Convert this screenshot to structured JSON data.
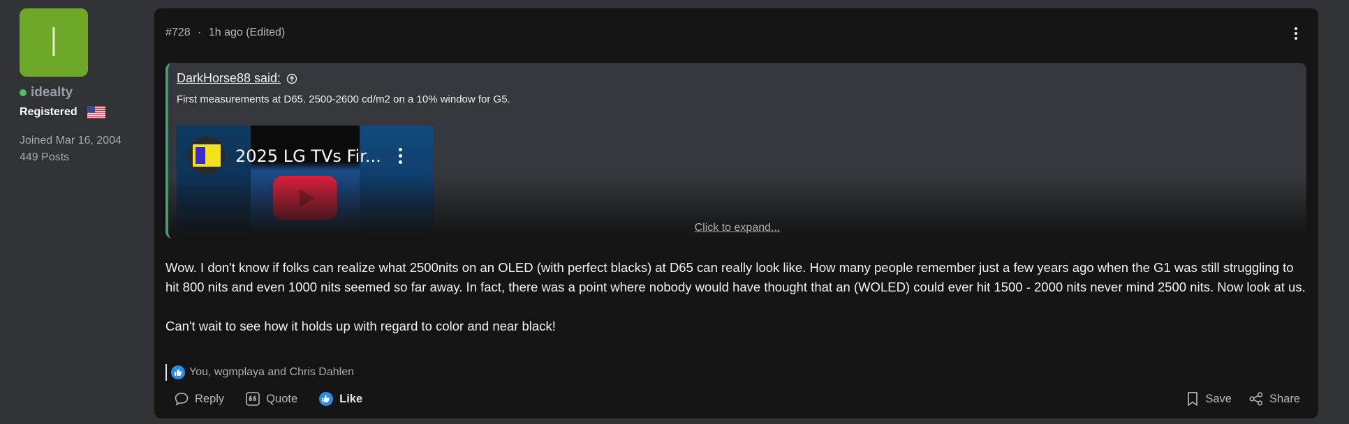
{
  "user": {
    "avatar_letter": "I",
    "avatar_color": "#6ea828",
    "username": "idealty",
    "online": true,
    "title": "Registered",
    "flag_icon": "us-flag-icon",
    "joined": "Joined Mar 16, 2004",
    "posts": "449 Posts"
  },
  "post": {
    "number": "#728",
    "separator": "·",
    "time": "1h ago (Edited)",
    "quote": {
      "author": "DarkHorse88 said:",
      "text": "First measurements at D65. 2500-2600 cd/m2 on a 10% window for G5.",
      "video_title": "2025 LG TVs Fir...",
      "expand_label": "Click to expand...",
      "accent_color": "#4a9a7a"
    },
    "body": [
      "Wow. I don't know if folks can realize what 2500nits on an OLED (with perfect blacks) at D65 can really look like. How many people remember just a few years ago when the G1 was still struggling to hit 800 nits and even 1000 nits seemed so far away. In fact, there was a point where nobody would have thought that an (WOLED) could ever hit 1500 - 2000 nits never mind 2500 nits. Now look at us.",
      "Can't wait to see how it holds up with regard to color and near black!"
    ],
    "reactions": "You, wgmplaya and Chris Dahlen",
    "actions": {
      "reply": "Reply",
      "quote": "Quote",
      "like": "Like",
      "save": "Save",
      "share": "Share"
    },
    "like_color": "#2b8de6"
  }
}
